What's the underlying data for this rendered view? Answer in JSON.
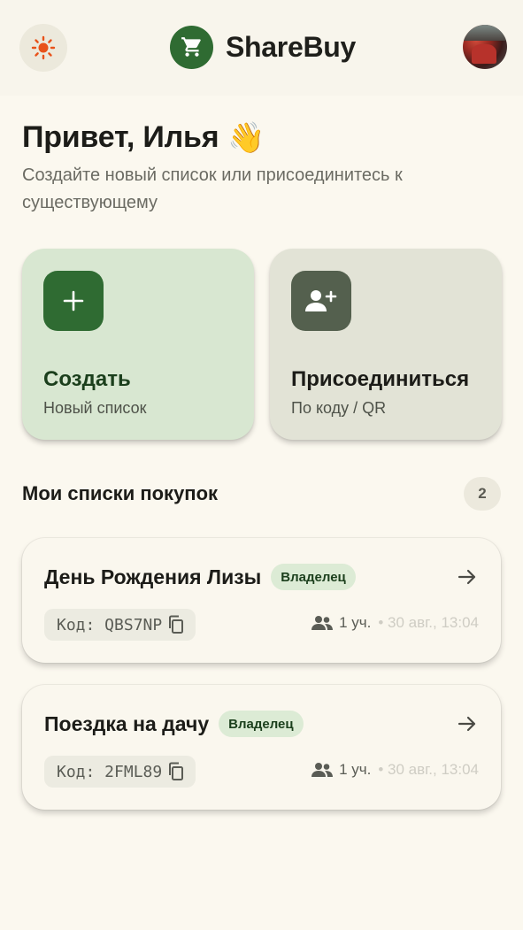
{
  "header": {
    "theme_icon": "sun-icon",
    "logo_icon": "shopping-cart-icon",
    "app_name": "ShareBuy",
    "avatar_icon": "user-avatar"
  },
  "greeting": {
    "title": "Привет, Илья",
    "emoji": "👋",
    "subtitle": "Создайте новый список или присоединитесь к существующему"
  },
  "actions": [
    {
      "icon": "plus-icon",
      "title": "Создать",
      "subtitle": "Новый список"
    },
    {
      "icon": "person-add-icon",
      "title": "Присоединиться",
      "subtitle": "По коду / QR"
    }
  ],
  "lists_section": {
    "title": "Мои списки покупок",
    "count": "2"
  },
  "lists": [
    {
      "name": "День Рождения Лизы",
      "role": "Владелец",
      "code": "Код: QBS7NP",
      "members": "1 уч.",
      "date": "• 30 авг., 13:04"
    },
    {
      "name": "Поездка на дачу",
      "role": "Владелец",
      "code": "Код: 2FML89",
      "members": "1 уч.",
      "date": "• 30 авг., 13:04"
    }
  ],
  "colors": {
    "background": "#fbf8ef",
    "primary": "#2f6b32",
    "secondary": "#54604e",
    "create_card": "#d8e7d1",
    "join_card": "#e2e3d6",
    "role_badge": "#dcebd5",
    "theme_icon": "#e8521a"
  }
}
